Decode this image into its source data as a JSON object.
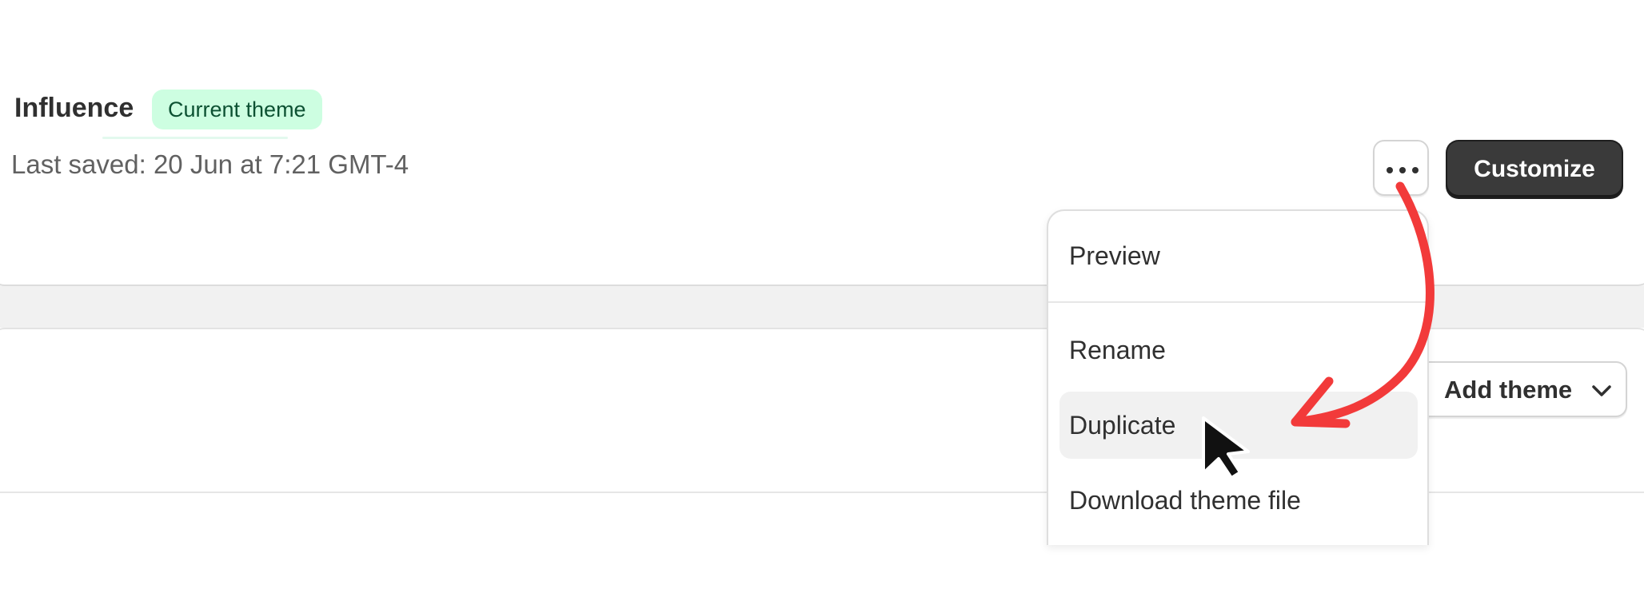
{
  "theme": {
    "name": "Influence",
    "badge": "Current theme",
    "last_saved": "Last saved: 20 Jun at 7:21 GMT-4",
    "customize_label": "Customize"
  },
  "library": {
    "add_theme_label": "Add theme"
  },
  "menu": {
    "items": [
      {
        "label": "Preview"
      },
      {
        "label": "Rename"
      },
      {
        "label": "Duplicate"
      },
      {
        "label": "Download theme file"
      }
    ],
    "highlighted": "Duplicate"
  },
  "colors": {
    "badge_bg": "#cdfee1",
    "badge_text": "#0c5132",
    "primary_button": "#3a3a3a",
    "annotation_arrow": "#f23a3a",
    "hover_bg": "#f1f1f1"
  },
  "icons": {
    "more": "horizontal-ellipsis",
    "add_theme": "chevron-down",
    "pointer": "mouse-cursor",
    "annotation": "curved-arrow"
  }
}
